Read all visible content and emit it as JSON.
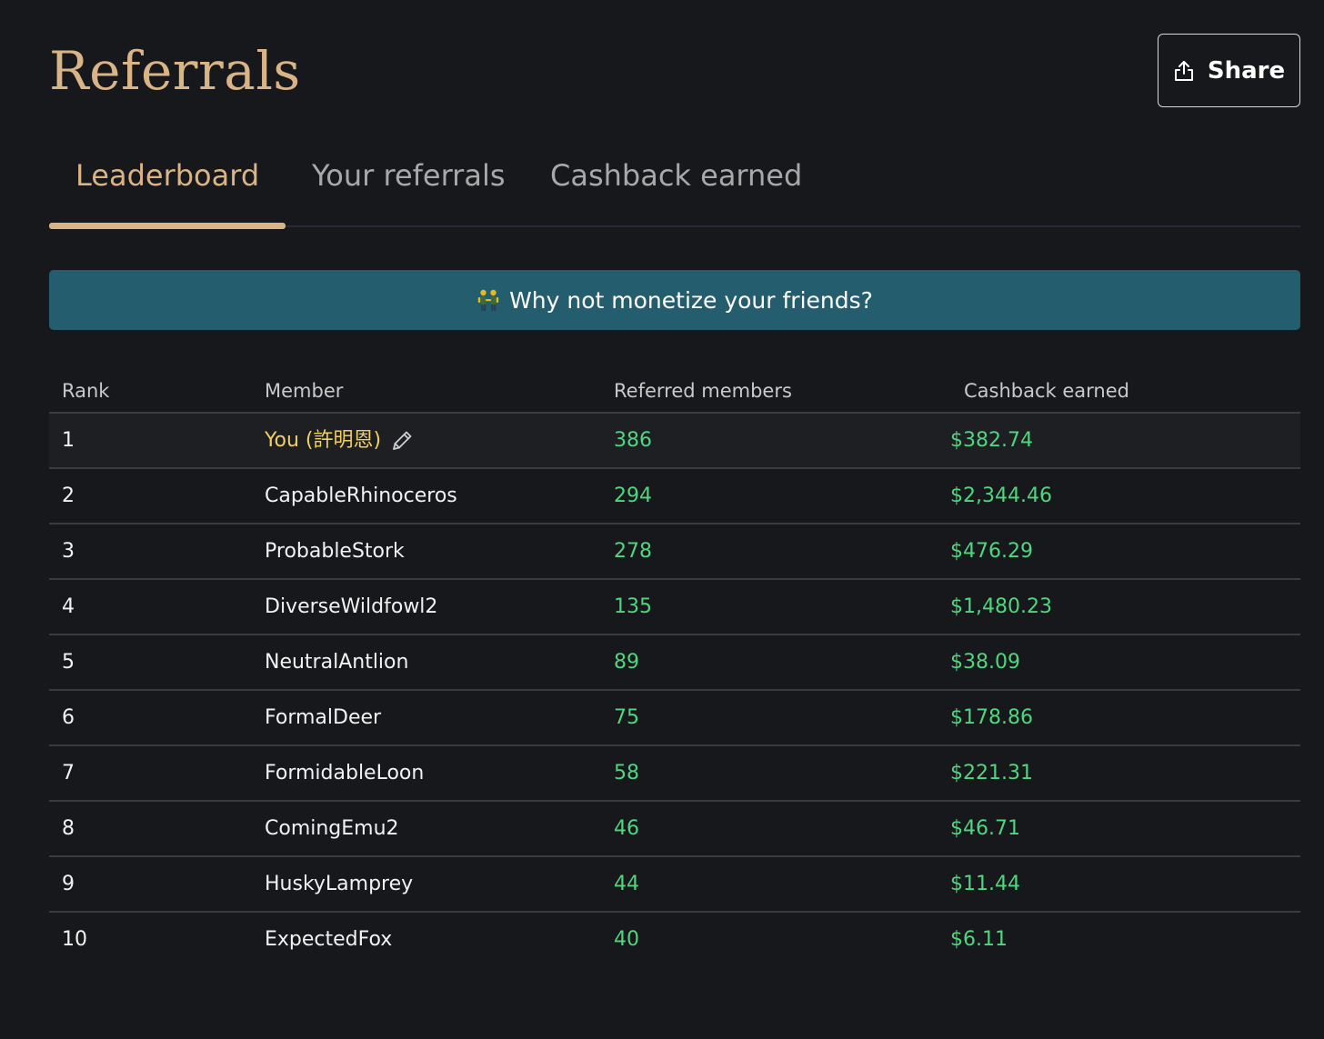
{
  "page": {
    "title": "Referrals"
  },
  "share_button": {
    "label": "Share",
    "icon": "share-upload-icon"
  },
  "tabs": [
    {
      "label": "Leaderboard",
      "active": true
    },
    {
      "label": "Your referrals",
      "active": false
    },
    {
      "label": "Cashback earned",
      "active": false
    }
  ],
  "banner": {
    "icon": "people-holding-hands-emoji",
    "text": "Why not monetize your friends?"
  },
  "table": {
    "columns": [
      "Rank",
      "Member",
      "Referred members",
      "Cashback earned"
    ],
    "rows": [
      {
        "rank": "1",
        "member": "You (許明恩)",
        "referred": "386",
        "cashback": "$382.74",
        "is_you": true
      },
      {
        "rank": "2",
        "member": "CapableRhinoceros",
        "referred": "294",
        "cashback": "$2,344.46"
      },
      {
        "rank": "3",
        "member": "ProbableStork",
        "referred": "278",
        "cashback": "$476.29"
      },
      {
        "rank": "4",
        "member": "DiverseWildfowl2",
        "referred": "135",
        "cashback": "$1,480.23"
      },
      {
        "rank": "5",
        "member": "NeutralAntlion",
        "referred": "89",
        "cashback": "$38.09"
      },
      {
        "rank": "6",
        "member": "FormalDeer",
        "referred": "75",
        "cashback": "$178.86"
      },
      {
        "rank": "7",
        "member": "FormidableLoon",
        "referred": "58",
        "cashback": "$221.31"
      },
      {
        "rank": "8",
        "member": "ComingEmu2",
        "referred": "46",
        "cashback": "$46.71"
      },
      {
        "rank": "9",
        "member": "HuskyLamprey",
        "referred": "44",
        "cashback": "$11.44"
      },
      {
        "rank": "10",
        "member": "ExpectedFox",
        "referred": "40",
        "cashback": "$6.11"
      }
    ]
  },
  "colors": {
    "background": "#17181b",
    "accent": "#d9b487",
    "banner": "#245e6e",
    "positive": "#4fd67e",
    "you_highlight": "#f1cf63"
  }
}
